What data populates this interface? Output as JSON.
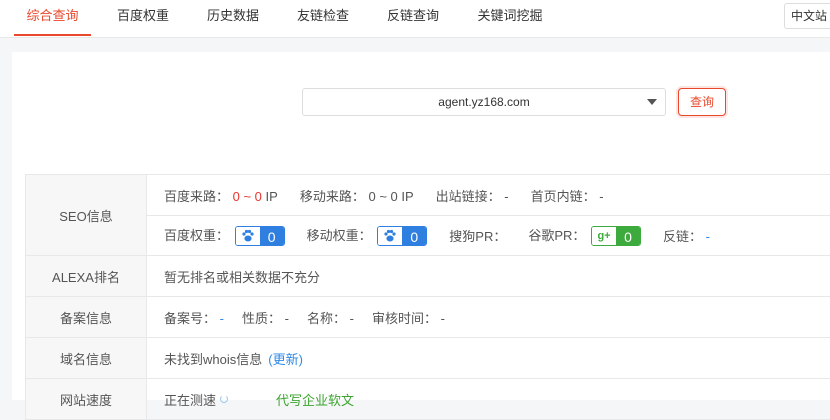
{
  "nav": {
    "tabs": [
      {
        "label": "综合查询",
        "active": true
      },
      {
        "label": "百度权重"
      },
      {
        "label": "历史数据"
      },
      {
        "label": "友链检查"
      },
      {
        "label": "反链查询"
      },
      {
        "label": "关键词挖掘"
      }
    ],
    "lang": "中文站"
  },
  "search": {
    "domain": "agent.yz168.com",
    "button": "查询"
  },
  "seo": {
    "label": "SEO信息",
    "baidu_source_label": "百度来路：",
    "baidu_source_value": "0 ~ 0",
    "baidu_source_unit": "IP",
    "mobile_source_label": "移动来路：",
    "mobile_source_value": "0 ~ 0 IP",
    "outlinks_label": "出站链接：",
    "outlinks_value": "-",
    "homepage_links_label": "首页内链：",
    "homepage_links_value": "-",
    "baidu_weight_label": "百度权重：",
    "baidu_weight_value": "0",
    "mobile_weight_label": "移动权重：",
    "mobile_weight_value": "0",
    "sogou_pr_label": "搜狗PR：",
    "google_pr_label": "谷歌PR：",
    "google_pr_value": "0",
    "backlinks_label": "反链：",
    "backlinks_value": "-"
  },
  "alexa": {
    "label": "ALEXA排名",
    "text": "暂无排名或相关数据不充分"
  },
  "icp": {
    "label": "备案信息",
    "number_label": "备案号：",
    "number_value": "-",
    "nature_label": "性质：",
    "nature_value": "-",
    "name_label": "名称：",
    "name_value": "-",
    "audit_label": "审核时间：",
    "audit_value": "-"
  },
  "whois": {
    "label": "域名信息",
    "text": "未找到whois信息",
    "update_link": "(更新)"
  },
  "speed": {
    "label": "网站速度",
    "text": "正在测速",
    "promo": "代写企业软文"
  },
  "colors": {
    "accent": "#e8482c",
    "link": "#2f8be6",
    "baidu_badge": "#2f7fe0",
    "google_badge": "#3caa3c"
  }
}
